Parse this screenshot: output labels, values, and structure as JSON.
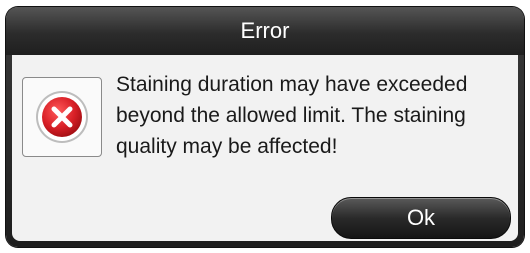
{
  "dialog": {
    "title": "Error",
    "icon": "error-x-icon",
    "message": "Staining duration may have exceeded beyond the allowed limit. The staining quality may be affected!",
    "ok_label": "Ok"
  },
  "colors": {
    "titlebar": "#2c2c2c",
    "body_bg": "#f2f2f2",
    "error_red": "#d81f26",
    "button_bg": "#2a2a2a"
  }
}
